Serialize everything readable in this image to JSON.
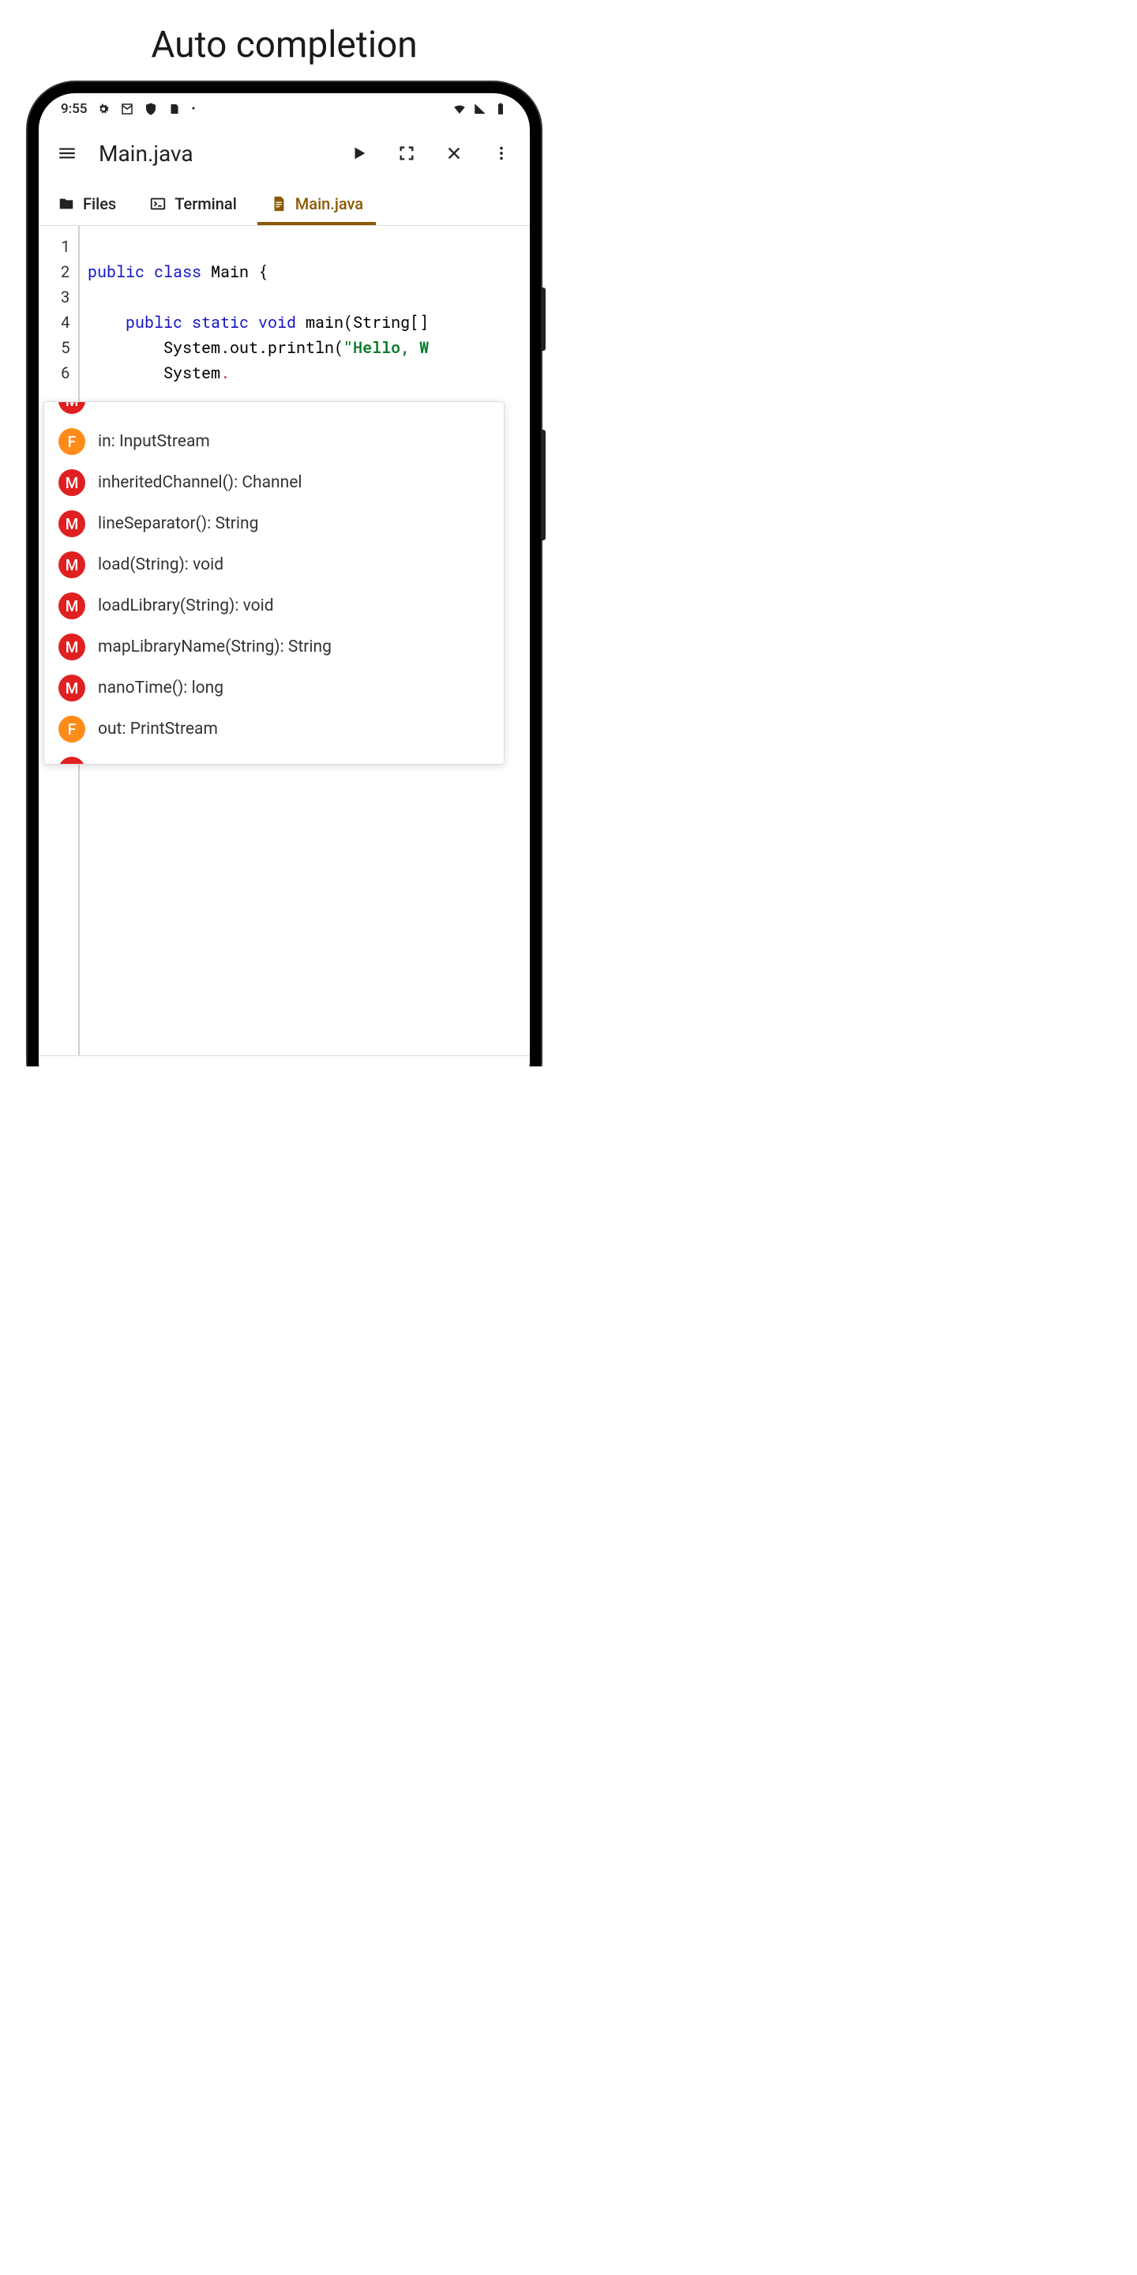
{
  "page_title": "Auto completion",
  "status": {
    "time": "9:55",
    "icons_left": [
      "gear-icon",
      "mail-icon",
      "shield-icon",
      "sd-icon",
      "dot-icon"
    ],
    "icons_right": [
      "wifi-icon",
      "signal-icon",
      "battery-icon"
    ]
  },
  "appbar": {
    "title": "Main.java"
  },
  "tabs": [
    {
      "icon": "folder-icon",
      "label": "Files",
      "active": false
    },
    {
      "icon": "terminal-icon",
      "label": "Terminal",
      "active": false
    },
    {
      "icon": "file-icon",
      "label": "Main.java",
      "active": true
    }
  ],
  "code": {
    "line_count": 6,
    "lines": {
      "l1": "",
      "l2_pre": "public class",
      "l2_rest": " Main {",
      "l4_pre": "    public static void",
      "l4_rest": " main(String[]",
      "l5_a": "        System.out.println(",
      "l5_str": "\"Hello, W",
      "l6_a": "        System",
      "l6_dot": "."
    }
  },
  "suggestions": [
    {
      "kind": "M",
      "label": "",
      "cut": "top"
    },
    {
      "kind": "F",
      "label": "in: InputStream"
    },
    {
      "kind": "M",
      "label": "inheritedChannel(): Channel"
    },
    {
      "kind": "M",
      "label": "lineSeparator(): String"
    },
    {
      "kind": "M",
      "label": "load(String): void"
    },
    {
      "kind": "M",
      "label": "loadLibrary(String): void"
    },
    {
      "kind": "M",
      "label": "mapLibraryName(String): String"
    },
    {
      "kind": "M",
      "label": "nanoTime(): long"
    },
    {
      "kind": "F",
      "label": "out: PrintStream"
    },
    {
      "kind": "M",
      "label": "",
      "cut": "bottom"
    }
  ],
  "bottom_toolbar": {
    "paren": "("
  }
}
